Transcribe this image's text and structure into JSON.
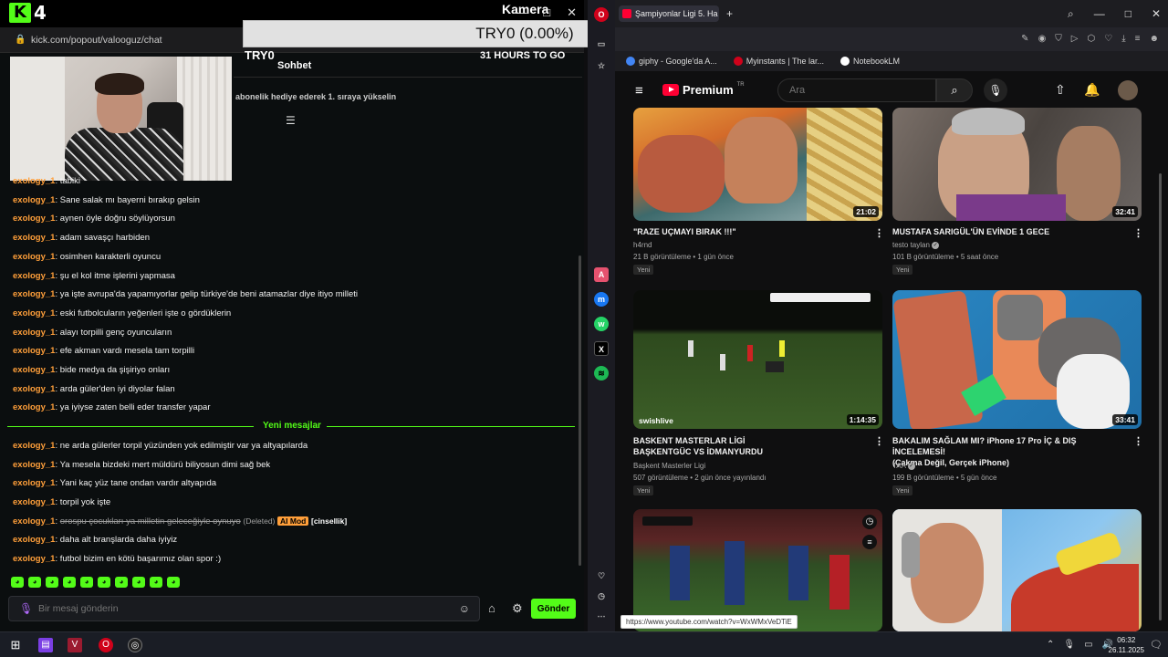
{
  "kick": {
    "logo_letter": "K",
    "logo_num": "4",
    "url": "kick.com/popout/valooguz/chat",
    "kamera_label": "Kamera",
    "goal_banner": "TRY0 (0.00%)",
    "try0_label": "TRY0",
    "hours_to_go": "31 HOURS TO GO",
    "sohbet": "Sohbet",
    "pinned_text": "abonelik hediye ederek 1. sıraya yükselin",
    "new_messages_label": "Yeni mesajlar",
    "messages_before": [
      {
        "user": "exology_1",
        "text": "tabiki"
      },
      {
        "user": "exology_1",
        "text": "Sane salak mı bayerni bırakıp gelsin"
      },
      {
        "user": "exology_1",
        "text": "aynen öyle doğru söylüyorsun"
      },
      {
        "user": "exology_1",
        "text": "adam savaşçı harbiden"
      },
      {
        "user": "exology_1",
        "text": "osimhen karakterli oyuncu"
      },
      {
        "user": "exology_1",
        "text": "şu el kol itme işlerini yapmasa"
      },
      {
        "user": "exology_1",
        "text": "ya işte avrupa'da yapamıyorlar gelip türkiye'de beni atamazlar diye itiyo milleti"
      },
      {
        "user": "exology_1",
        "text": "eski futbolcuların yeğenleri işte o gördüklerin"
      },
      {
        "user": "exology_1",
        "text": "alayı torpilli genç oyuncuların"
      },
      {
        "user": "exology_1",
        "text": "efe akman vardı mesela tam torpilli"
      },
      {
        "user": "exology_1",
        "text": "bide medya da şişiriyo onları"
      },
      {
        "user": "exology_1",
        "text": "arda güler'den iyi diyolar falan"
      },
      {
        "user": "exology_1",
        "text": "ya iyiyse zaten belli eder transfer yapar"
      }
    ],
    "messages_after": [
      {
        "user": "exology_1",
        "text": "ne arda gülerler torpil yüzünden yok edilmiştir var ya altyapılarda"
      },
      {
        "user": "exology_1",
        "text": "Ya mesela bizdeki mert müldürü biliyosun dimi sağ bek"
      },
      {
        "user": "exology_1",
        "text": "Yani kaç yüz tane ondan vardır altyapıda"
      },
      {
        "user": "exology_1",
        "text": "torpil yok işte"
      }
    ],
    "deleted_message": {
      "user": "exology_1",
      "text": "orospu çocukları ya milletin geleceğiyle oynuyo",
      "deleted_tag": "(Deleted)",
      "mod_tag": "AI Mod",
      "reason_tag": "[cinsellik]"
    },
    "messages_last": [
      {
        "user": "exology_1",
        "text": "daha alt branşlarda daha iyiyiz"
      },
      {
        "user": "exology_1",
        "text": "futbol bizim en kötü başarımız olan spor :)"
      }
    ],
    "input_placeholder": "Bir mesaj gönderin",
    "send_label": "Gönder",
    "accent": "#53fc18",
    "username_color": "#ff9f3a"
  },
  "browser": {
    "tab_title": "Şampiyonlar Ligi 5. Ha",
    "bookmarks": [
      {
        "label": "giphy - Google'da A...",
        "color": "#4285f4"
      },
      {
        "label": "Myinstants | The lar...",
        "color": "#d0021b"
      },
      {
        "label": "NotebookLM",
        "color": "#ffffff"
      }
    ],
    "status_url": "https://www.youtube.com/watch?v=WxWMxVeDTiE"
  },
  "youtube": {
    "logo_text": "Premium",
    "logo_sup": "TR",
    "search_placeholder": "Ara",
    "videos": [
      {
        "title": "\"RAZE UÇMAYI BIRAK !!!\"",
        "title2": "",
        "channel": "h4rnd",
        "verified": false,
        "meta": "21 B görüntüleme • 1 gün önce",
        "badge": "Yeni",
        "duration": "21:02"
      },
      {
        "title": "MUSTAFA SARIGÜL'ÜN EVİNDE 1 GECE",
        "title2": "",
        "channel": "testo taylan",
        "verified": true,
        "meta": "101 B görüntüleme • 5 saat önce",
        "badge": "Yeni",
        "duration": "32:41"
      },
      {
        "title": "BASKENT MASTERLAR LİGİ",
        "title2": "BAŞKENTGÜC VS İDMANYURDU",
        "channel": "Başkent Masterler Ligi",
        "verified": false,
        "meta": "507 görüntüleme • 2 gün önce yayınlandı",
        "badge": "Yeni",
        "duration": "1:14:35",
        "watermark": "swishlive"
      },
      {
        "title": "BAKALIM SAĞLAM MI? iPhone 17 Pro İÇ & DIŞ İNCELEMESİ!",
        "title2": "(Çakma Değil, Gerçek iPhone)",
        "channel": "TAA",
        "verified": true,
        "meta": "199 B görüntüleme • 5 gün önce",
        "badge": "Yeni",
        "duration": "33:41"
      }
    ]
  },
  "taskbar": {
    "time": "06:32",
    "date": "26.11.2025"
  }
}
